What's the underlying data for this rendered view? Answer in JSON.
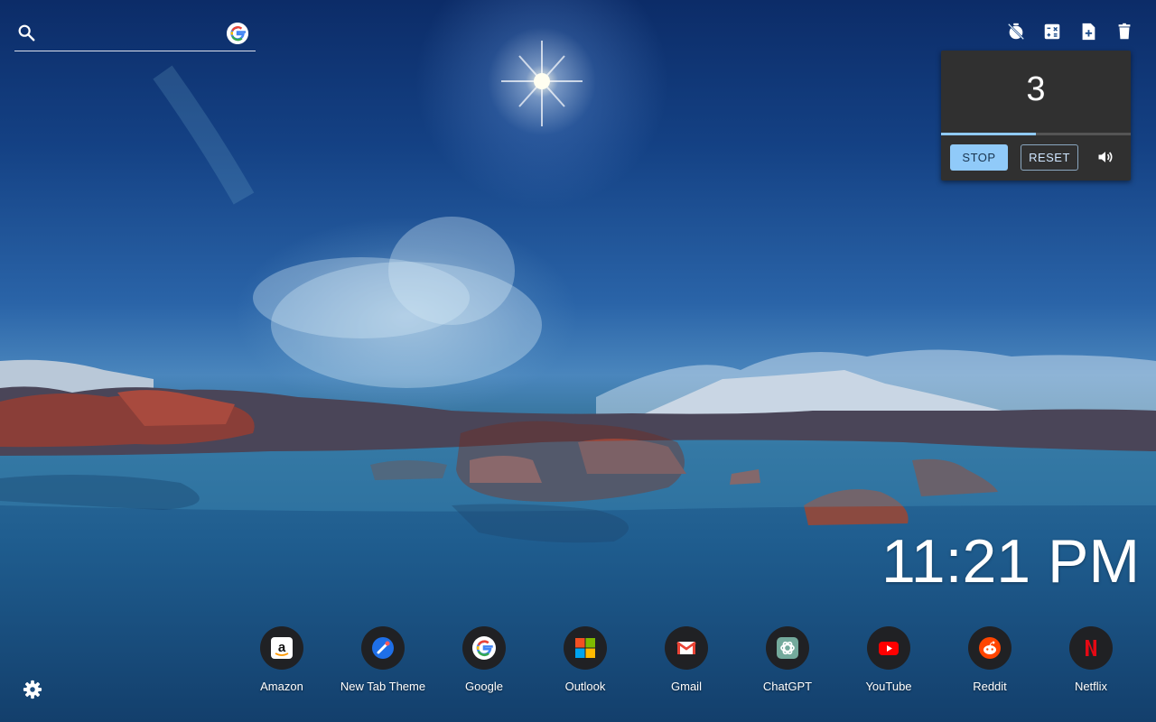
{
  "search": {
    "value": "",
    "placeholder": "",
    "icon": "search-icon",
    "engine_icon": "google-icon"
  },
  "toolbar": {
    "icons": [
      "timer-off-icon",
      "calculator-icon",
      "note-add-icon",
      "trash-icon"
    ]
  },
  "timer": {
    "count": "3",
    "progress": 0.5,
    "stop_label": "STOP",
    "reset_label": "RESET",
    "volume_icon": "volume-icon",
    "accent": "#90caf9"
  },
  "clock": {
    "time": "11:21 PM"
  },
  "shortcuts": [
    {
      "label": "Amazon",
      "icon": "amazon-icon"
    },
    {
      "label": "New Tab Theme",
      "icon": "new-tab-theme-icon"
    },
    {
      "label": "Google",
      "icon": "google-icon"
    },
    {
      "label": "Outlook",
      "icon": "outlook-icon"
    },
    {
      "label": "Gmail",
      "icon": "gmail-icon"
    },
    {
      "label": "ChatGPT",
      "icon": "chatgpt-icon"
    },
    {
      "label": "YouTube",
      "icon": "youtube-icon"
    },
    {
      "label": "Reddit",
      "icon": "reddit-icon"
    },
    {
      "label": "Netflix",
      "icon": "netflix-icon"
    }
  ],
  "settings": {
    "icon": "gear-icon"
  }
}
